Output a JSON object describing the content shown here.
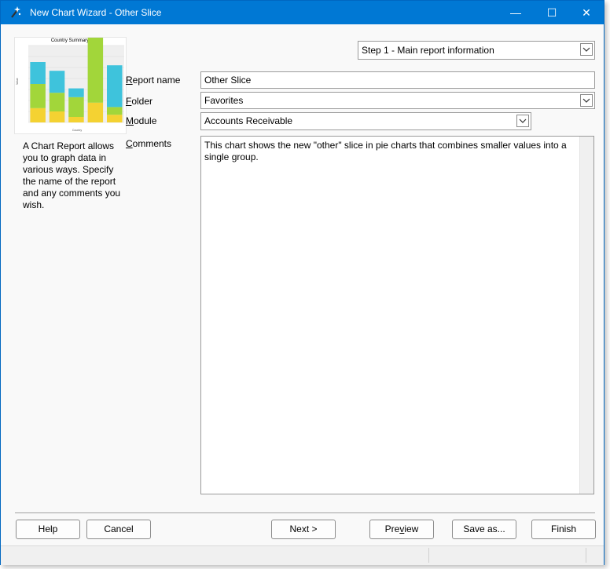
{
  "window": {
    "title": "New Chart Wizard - Other Slice",
    "minimize_glyph": "—",
    "maximize_glyph": "☐",
    "close_glyph": "✕"
  },
  "preview": {
    "chart_data": {
      "type": "bar",
      "title": "Country Summary",
      "xlabel": "Country",
      "ylabel": "Value",
      "categories": [
        "",
        "",
        "",
        "",
        ""
      ],
      "series": [
        {
          "color": "#f4d232",
          "values": [
            13000,
            10000,
            5000,
            18000,
            7000
          ]
        },
        {
          "color": "#a2d63a",
          "values": [
            22000,
            17000,
            18000,
            62000,
            7000
          ]
        },
        {
          "color": "#3ec3dc",
          "values": [
            20000,
            20000,
            8000,
            8000,
            38000
          ]
        }
      ],
      "ylim": [
        0,
        70000
      ],
      "grid": true
    }
  },
  "description": "A Chart Report allows you to graph data in various ways. Specify the name of the report and any comments you wish.",
  "step_select": {
    "value": "Step 1 - Main report information"
  },
  "form": {
    "report_name_label_first": "R",
    "report_name_label_rest": "eport name",
    "report_name_value": "Other Slice",
    "folder_label_first": "F",
    "folder_label_rest": "older",
    "folder_value": "Favorites",
    "module_label_first": "M",
    "module_label_rest": "odule",
    "module_value": "Accounts Receivable",
    "comments_label_first": "C",
    "comments_label_rest": "omments",
    "comments_value": "This chart shows the new \"other\" slice in pie charts that combines smaller values into a single group."
  },
  "buttons": {
    "help": "Help",
    "cancel": "Cancel",
    "next": "Next >",
    "preview_pre": "Pre",
    "preview_u": "v",
    "preview_post": "iew",
    "save_as": "Save as...",
    "finish": "Finish"
  }
}
